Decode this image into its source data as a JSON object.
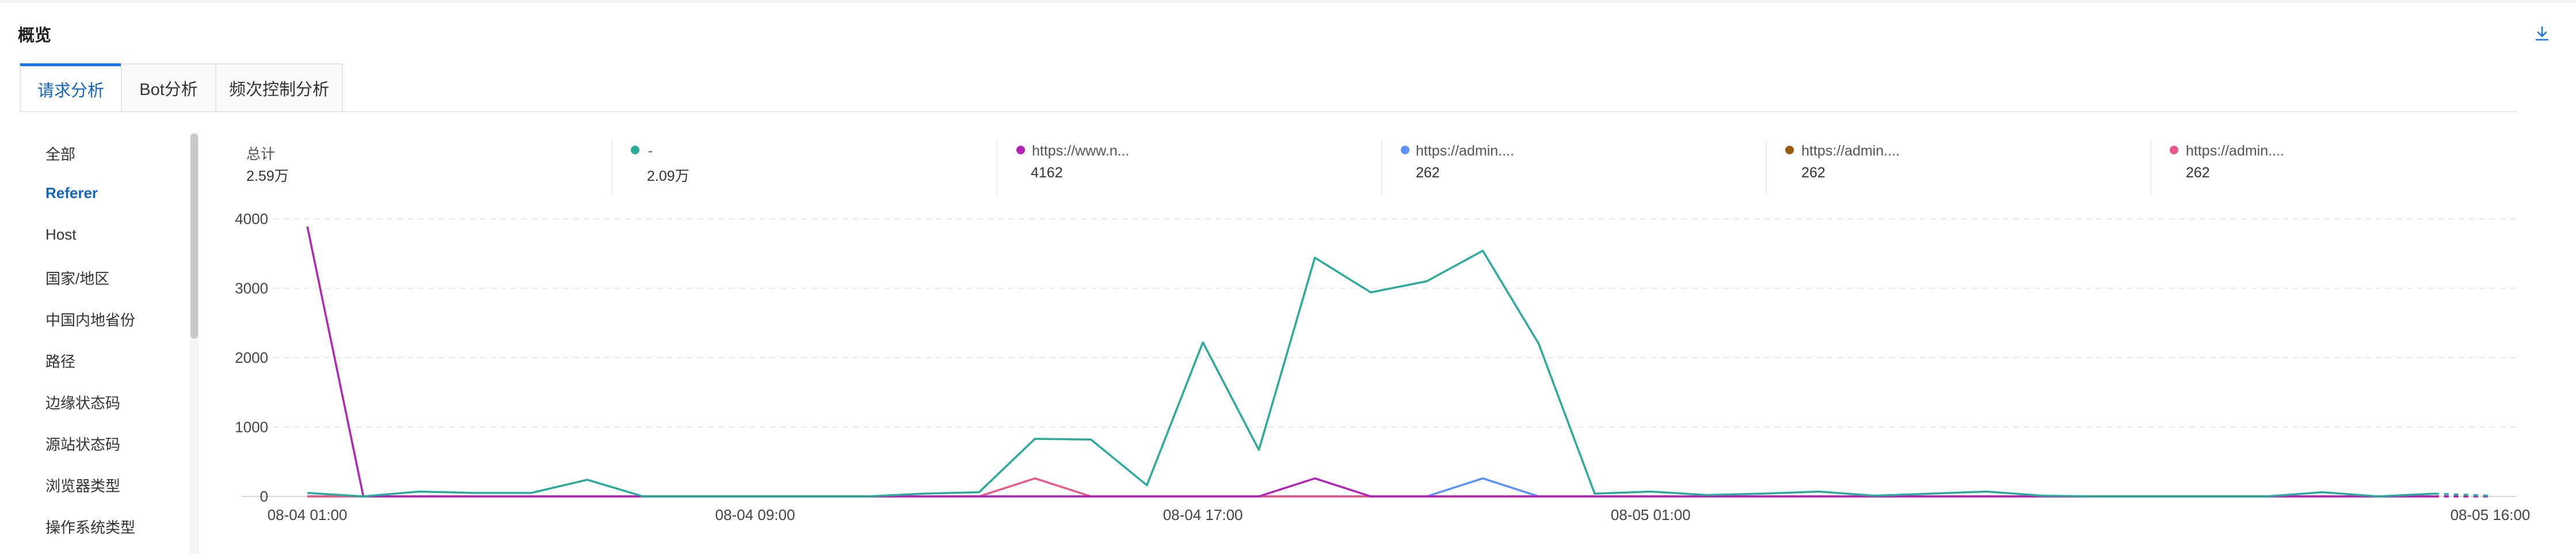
{
  "header": {
    "title": "概览",
    "download_icon": "download-icon"
  },
  "tabs": [
    {
      "label": "请求分析",
      "active": true
    },
    {
      "label": "Bot分析",
      "active": false
    },
    {
      "label": "频次控制分析",
      "active": false
    }
  ],
  "sidebar": {
    "items": [
      {
        "label": "全部",
        "active": false
      },
      {
        "label": "Referer",
        "active": true
      },
      {
        "label": "Host",
        "active": false
      },
      {
        "label": "国家/地区",
        "active": false
      },
      {
        "label": "中国内地省份",
        "active": false
      },
      {
        "label": "路径",
        "active": false
      },
      {
        "label": "边缘状态码",
        "active": false
      },
      {
        "label": "源站状态码",
        "active": false
      },
      {
        "label": "浏览器类型",
        "active": false
      },
      {
        "label": "操作系统类型",
        "active": false
      }
    ]
  },
  "legend": [
    {
      "name": "总计",
      "value": "2.59万",
      "color": ""
    },
    {
      "name": "-",
      "value": "2.09万",
      "color": "#2ba99b"
    },
    {
      "name": "https://www.n...",
      "value": "4162",
      "color": "#b125b5"
    },
    {
      "name": "https://admin....",
      "value": "262",
      "color": "#5b8ff9"
    },
    {
      "name": "https://admin....",
      "value": "262",
      "color": "#9a5b0f"
    },
    {
      "name": "https://admin....",
      "value": "262",
      "color": "#e8588a"
    }
  ],
  "chart_data": {
    "type": "line",
    "x": [
      "08-04 01:00",
      "08-04 02:00",
      "08-04 03:00",
      "08-04 04:00",
      "08-04 05:00",
      "08-04 06:00",
      "08-04 07:00",
      "08-04 08:00",
      "08-04 09:00",
      "08-04 10:00",
      "08-04 11:00",
      "08-04 12:00",
      "08-04 13:00",
      "08-04 14:00",
      "08-04 15:00",
      "08-04 16:00",
      "08-04 17:00",
      "08-04 18:00",
      "08-04 19:00",
      "08-04 20:00",
      "08-04 21:00",
      "08-04 22:00",
      "08-04 23:00",
      "08-05 00:00",
      "08-05 01:00",
      "08-05 02:00",
      "08-05 03:00",
      "08-05 04:00",
      "08-05 05:00",
      "08-05 06:00",
      "08-05 07:00",
      "08-05 08:00",
      "08-05 09:00",
      "08-05 10:00",
      "08-05 11:00",
      "08-05 12:00",
      "08-05 13:00",
      "08-05 14:00",
      "08-05 15:00",
      "08-05 16:00"
    ],
    "x_ticks": [
      "08-04 01:00",
      "08-04 09:00",
      "08-04 17:00",
      "08-05 01:00",
      "08-05 16:00"
    ],
    "ylim": [
      0,
      4000
    ],
    "y_ticks": [
      0,
      1000,
      2000,
      3000,
      4000
    ],
    "grid": true,
    "legend_position": "top",
    "series": [
      {
        "name": "-",
        "color": "#2ba99b",
        "values": [
          50,
          0,
          70,
          50,
          50,
          240,
          0,
          0,
          0,
          0,
          0,
          40,
          60,
          830,
          820,
          160,
          2220,
          670,
          3440,
          2940,
          3100,
          3540,
          2200,
          40,
          70,
          20,
          40,
          70,
          10,
          40,
          70,
          10,
          0,
          0,
          0,
          0,
          60,
          0,
          40,
          10
        ]
      },
      {
        "name": "https://www.n...",
        "color": "#b125b5",
        "values": [
          3890,
          0,
          0,
          0,
          0,
          0,
          0,
          0,
          0,
          0,
          0,
          0,
          0,
          0,
          0,
          0,
          0,
          0,
          260,
          0,
          0,
          0,
          0,
          0,
          0,
          0,
          0,
          0,
          0,
          0,
          0,
          0,
          0,
          0,
          0,
          0,
          0,
          0,
          0,
          0
        ]
      },
      {
        "name": "https://admin....",
        "color": "#5b8ff9",
        "values": [
          0,
          0,
          0,
          0,
          0,
          0,
          0,
          0,
          0,
          0,
          0,
          0,
          0,
          0,
          0,
          0,
          0,
          0,
          0,
          0,
          0,
          260,
          0,
          0,
          0,
          0,
          0,
          0,
          0,
          0,
          0,
          0,
          0,
          0,
          0,
          0,
          0,
          0,
          0,
          0
        ]
      },
      {
        "name": "https://admin....",
        "color": "#9a5b0f",
        "values": [
          0,
          0,
          0,
          0,
          0,
          0,
          0,
          0,
          0,
          0,
          0,
          0,
          0,
          0,
          0,
          0,
          0,
          0,
          0,
          0,
          0,
          0,
          0,
          0,
          0,
          0,
          0,
          0,
          0,
          0,
          0,
          0,
          0,
          0,
          0,
          0,
          0,
          0,
          0,
          0
        ]
      },
      {
        "name": "https://admin....",
        "color": "#e8588a",
        "values": [
          0,
          0,
          0,
          0,
          0,
          0,
          0,
          0,
          0,
          0,
          0,
          0,
          0,
          260,
          0,
          0,
          0,
          0,
          0,
          0,
          0,
          0,
          0,
          0,
          0,
          0,
          0,
          0,
          0,
          0,
          0,
          0,
          0,
          0,
          0,
          0,
          0,
          0,
          0,
          0
        ]
      }
    ]
  }
}
